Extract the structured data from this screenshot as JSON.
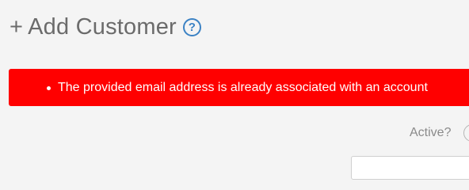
{
  "header": {
    "plus": "+",
    "title": "Add Customer",
    "help_icon_name": "question-circle-icon",
    "help_glyph": "?"
  },
  "error_banner": {
    "color": "#ff0000",
    "messages": [
      "The provided email address is already associated with an account"
    ]
  },
  "form": {
    "active_label": "Active?"
  }
}
